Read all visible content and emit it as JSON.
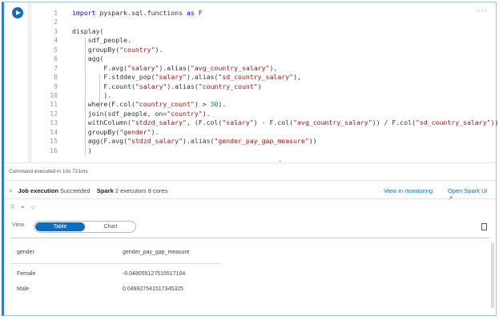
{
  "code_lines": [
    [
      [
        "import",
        "kw"
      ],
      [
        " pyspark.sql.functions ",
        ""
      ],
      [
        "as",
        "kw"
      ],
      [
        " F",
        ""
      ]
    ],
    [],
    [
      [
        "display(",
        ""
      ]
    ],
    [
      [
        "    sdf_people.",
        ""
      ]
    ],
    [
      [
        "    groupBy(",
        ""
      ],
      [
        "\"country\"",
        "str"
      ],
      [
        ").",
        ""
      ]
    ],
    [
      [
        "    agg(",
        ""
      ]
    ],
    [
      [
        "        F.avg(",
        ""
      ],
      [
        "\"salary\"",
        "str"
      ],
      [
        ").alias(",
        ""
      ],
      [
        "\"avg_country_salary\"",
        "str"
      ],
      [
        "),",
        ""
      ]
    ],
    [
      [
        "        F.stddev_pop(",
        ""
      ],
      [
        "\"salary\"",
        "str"
      ],
      [
        ").alias(",
        ""
      ],
      [
        "\"sd_country_salary\"",
        "str"
      ],
      [
        "),",
        ""
      ]
    ],
    [
      [
        "        F.count(",
        ""
      ],
      [
        "\"salary\"",
        "str"
      ],
      [
        ").alias(",
        ""
      ],
      [
        "\"country_count\"",
        "str"
      ],
      [
        ")",
        ""
      ]
    ],
    [
      [
        "        ).",
        ""
      ]
    ],
    [
      [
        "    where(F.col(",
        ""
      ],
      [
        "\"country_count\"",
        "str"
      ],
      [
        ") > ",
        ""
      ],
      [
        "30",
        "num"
      ],
      [
        ").",
        ""
      ]
    ],
    [
      [
        "    join(sdf_people, on=",
        ""
      ],
      [
        "\"country\"",
        "str"
      ],
      [
        ").",
        ""
      ]
    ],
    [
      [
        "    withColumn(",
        ""
      ],
      [
        "\"stdzd_salary\"",
        "str"
      ],
      [
        ", (F.col(",
        ""
      ],
      [
        "\"salary\"",
        "str"
      ],
      [
        ") - F.col(",
        ""
      ],
      [
        "\"avg_country_salary\"",
        "str"
      ],
      [
        ")) / F.col(",
        ""
      ],
      [
        "\"sd_country_salary\"",
        "str"
      ],
      [
        ")).",
        ""
      ]
    ],
    [
      [
        "    groupBy(",
        ""
      ],
      [
        "\"gender\"",
        "str"
      ],
      [
        ").",
        ""
      ]
    ],
    [
      [
        "    agg(F.avg(",
        ""
      ],
      [
        "\"stdzd_salary\"",
        "str"
      ],
      [
        ").alias(",
        ""
      ],
      [
        "\"gender_pay_gap_measure\"",
        "str"
      ],
      [
        "))",
        ""
      ]
    ],
    [
      [
        "    )",
        ""
      ]
    ]
  ],
  "status": "Command executed in 10s 721ms",
  "job": {
    "label": "Job execution",
    "state": "Succeeded",
    "spark_label": "Spark",
    "spark_info": "2 executors 8 cores",
    "monitor_link": "View in monitoring",
    "spark_ui_link": "Open Spark UI"
  },
  "view": {
    "label": "View",
    "table": "Table",
    "chart": "Chart"
  },
  "table": {
    "headers": [
      "gender",
      "gender_pay_gap_measure"
    ],
    "rows": [
      [
        "Female",
        "-0.0480551275155171 04"
      ],
      [
        "Male",
        "0.049927541517345325"
      ]
    ]
  }
}
